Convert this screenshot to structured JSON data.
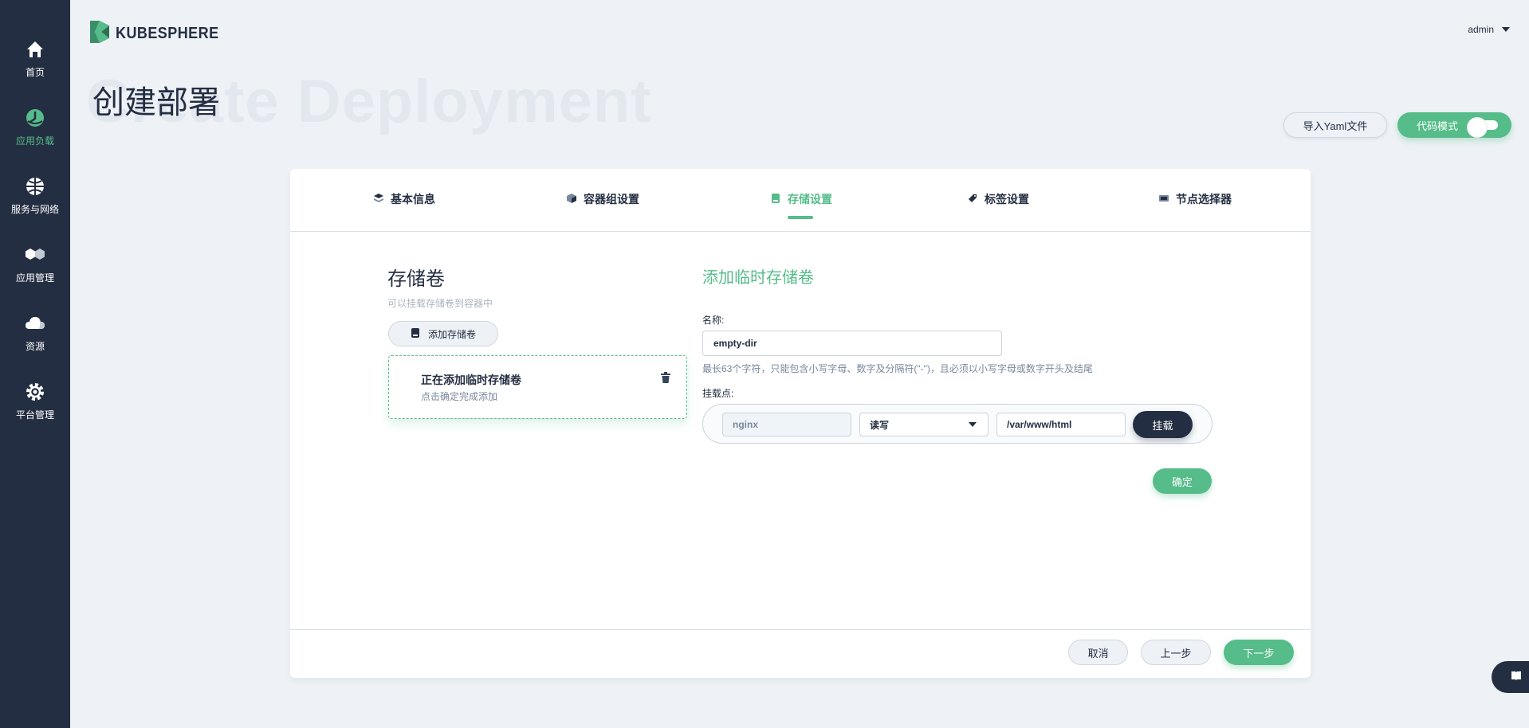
{
  "brand": {
    "name": "KUBESPHERE",
    "accent": "#55bc8a",
    "dark": "#242e42"
  },
  "user": {
    "name": "admin"
  },
  "sidebar": {
    "items": [
      {
        "label": "首页",
        "icon": "home-icon",
        "active": false
      },
      {
        "label": "应用负载",
        "icon": "workload-icon",
        "active": true
      },
      {
        "label": "服务与网络",
        "icon": "network-icon",
        "active": false
      },
      {
        "label": "应用管理",
        "icon": "app-management-icon",
        "active": false
      },
      {
        "label": "资源",
        "icon": "cloud-icon",
        "active": false
      },
      {
        "label": "平台管理",
        "icon": "gear-icon",
        "active": false
      }
    ]
  },
  "page": {
    "title": "创建部署",
    "title_watermark": "Create Deployment",
    "import_yaml_label": "导入Yaml文件",
    "code_mode_label": "代码模式"
  },
  "tabs": [
    {
      "label": "基本信息",
      "icon": "layers-icon",
      "active": false
    },
    {
      "label": "容器组设置",
      "icon": "cube-icon",
      "active": false
    },
    {
      "label": "存储设置",
      "icon": "storage-icon",
      "active": true
    },
    {
      "label": "标签设置",
      "icon": "tag-icon",
      "active": false
    },
    {
      "label": "节点选择器",
      "icon": "node-icon",
      "active": false
    }
  ],
  "volumes": {
    "title": "存储卷",
    "description": "可以挂载存储卷到容器中",
    "add_button_label": "添加存储卷",
    "pending_title": "正在添加临时存储卷",
    "pending_subtitle": "点击确定完成添加"
  },
  "form": {
    "title": "添加临时存储卷",
    "name_label": "名称:",
    "name_value": "empty-dir",
    "name_hint": "最长63个字符，只能包含小写字母、数字及分隔符(\"-\")，且必须以小写字母或数字开头及结尾",
    "mount_label": "挂载点:",
    "mount_container": "nginx",
    "mount_mode": "读写",
    "mount_path": "/var/www/html",
    "mount_button_label": "挂载",
    "confirm_label": "确定"
  },
  "footer": {
    "cancel_label": "取消",
    "prev_label": "上一步",
    "next_label": "下一步"
  }
}
